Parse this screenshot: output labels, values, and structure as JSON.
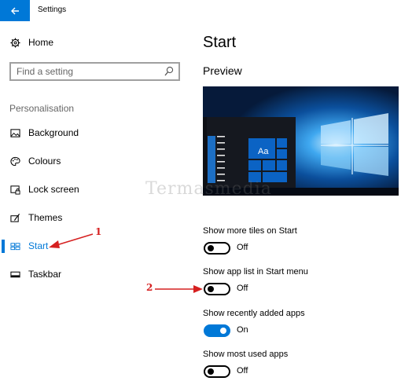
{
  "window": {
    "title": "Settings"
  },
  "sidebar": {
    "home_label": "Home",
    "search_placeholder": "Find a setting",
    "section_heading": "Personalisation",
    "items": [
      {
        "label": "Background",
        "icon": "image-icon"
      },
      {
        "label": "Colours",
        "icon": "palette-icon"
      },
      {
        "label": "Lock screen",
        "icon": "lock-screen-icon"
      },
      {
        "label": "Themes",
        "icon": "themes-icon"
      },
      {
        "label": "Start",
        "icon": "start-icon",
        "active": true
      },
      {
        "label": "Taskbar",
        "icon": "taskbar-icon"
      }
    ]
  },
  "main": {
    "title": "Start",
    "preview_heading": "Preview",
    "preview_tile_label": "Aa",
    "watermark": "Termasmedia",
    "settings": [
      {
        "label": "Show more tiles on Start",
        "state": "Off",
        "on": false
      },
      {
        "label": "Show app list in Start menu",
        "state": "Off",
        "on": false
      },
      {
        "label": "Show recently added apps",
        "state": "On",
        "on": true
      },
      {
        "label": "Show most used apps",
        "state": "Off",
        "on": false
      }
    ]
  },
  "annotations": {
    "marker_1": "1",
    "marker_2": "2"
  },
  "colors": {
    "accent": "#0078d7",
    "annotation": "#d62020"
  }
}
